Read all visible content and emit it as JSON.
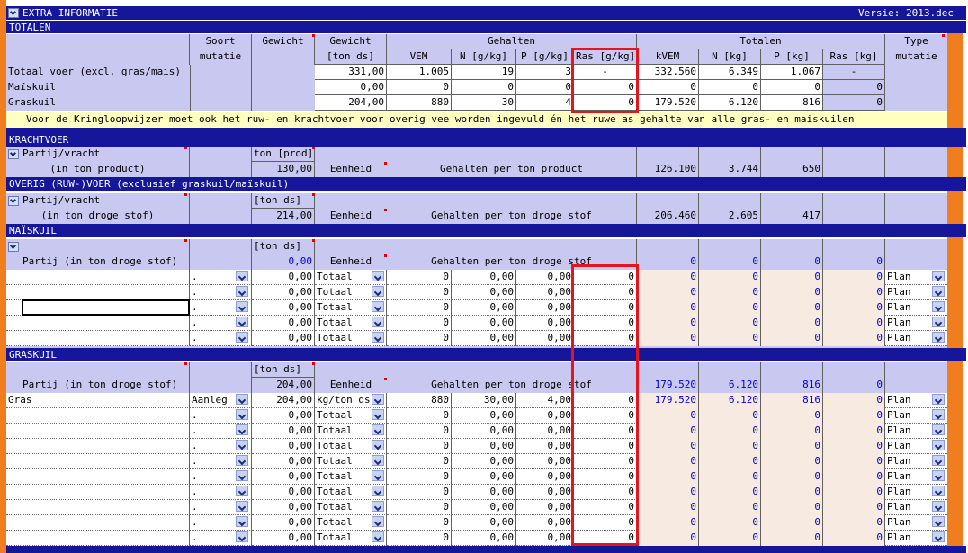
{
  "header": {
    "title": "EXTRA INFORMATIE",
    "version": "Versie: 2013.dec"
  },
  "totalen": {
    "section": "TOTALEN",
    "cols": {
      "soort": "Soort",
      "mutatie": "mutatie",
      "gewicht1": "Gewicht",
      "gewicht2": "Gewicht",
      "tonds": "[ton ds]",
      "gehalten": "Gehalten",
      "vem": "VEM",
      "n": "N [g/kg]",
      "p": "P [g/kg]",
      "ras": "Ras [g/kg]",
      "totalen": "Totalen",
      "kvem": "kVEM",
      "nkg": "N [kg]",
      "pkg": "P [kg]",
      "raskg": "Ras [kg]",
      "type": "Type",
      "typemut": "mutatie"
    },
    "rows": [
      {
        "label": "Totaal voer (excl. gras/mais)",
        "w": "331,00",
        "vem": "1.005",
        "n": "19",
        "p": "3",
        "ras": "-",
        "kvem": "332.560",
        "nkg": "6.349",
        "pkg": "1.067",
        "raskg": "-"
      },
      {
        "label": "Maïskuil",
        "w": "0,00",
        "vem": "0",
        "n": "0",
        "p": "0",
        "ras": "0",
        "kvem": "0",
        "nkg": "0",
        "pkg": "0",
        "raskg": "0"
      },
      {
        "label": "Graskuil",
        "w": "204,00",
        "vem": "880",
        "n": "30",
        "p": "4",
        "ras": "0",
        "kvem": "179.520",
        "nkg": "6.120",
        "pkg": "816",
        "raskg": "0"
      }
    ],
    "note": "Voor de Kringloopwijzer moet ook het ruw- en krachtvoer voor overig vee worden ingevuld én het ruwe as gehalte van alle gras- en maiskuilen"
  },
  "kracht": {
    "section": "KRACHTVOER",
    "partij": "Partij/vracht",
    "unit": "ton [prod]",
    "sub": "(in ton product)",
    "w": "130,00",
    "eenheid": "Eenheid",
    "gehalten": "Gehalten per ton product",
    "kvem": "126.100",
    "nkg": "3.744",
    "pkg": "650"
  },
  "overig": {
    "section": "OVERIG (RUW-)VOER (exclusief graskuil/maïskuil)",
    "partij": "Partij/vracht",
    "unit": "[ton ds]",
    "sub": "(in ton droge stof)",
    "w": "214,00",
    "eenheid": "Eenheid",
    "gehalten": "Gehalten per ton droge stof",
    "kvem": "206.460",
    "nkg": "2.605",
    "pkg": "417"
  },
  "mais": {
    "section": "MAÏSKUIL",
    "unit": "[ton ds]",
    "partij": "Partij (in ton droge stof)",
    "w": "0,00",
    "eenheid": "Eenheid",
    "gehalten": "Gehalten per ton droge stof",
    "kvem": "0",
    "nkg": "0",
    "pkg": "0",
    "raskg": "0",
    "rows": [
      {
        "name": "",
        "soort": ".",
        "w": "0,00",
        "eenheid": "Totaal",
        "vem": "0",
        "n": "0,00",
        "p": "0,00",
        "ras": "0",
        "kvem": "0",
        "nkg": "0",
        "pkg": "0",
        "raskg": "0",
        "type": "Plan"
      },
      {
        "name": "",
        "soort": ".",
        "w": "0,00",
        "eenheid": "Totaal",
        "vem": "0",
        "n": "0,00",
        "p": "0,00",
        "ras": "0",
        "kvem": "0",
        "nkg": "0",
        "pkg": "0",
        "raskg": "0",
        "type": "Plan"
      },
      {
        "name": "",
        "soort": ".",
        "w": "0,00",
        "eenheid": "Totaal",
        "vem": "0",
        "n": "0,00",
        "p": "0,00",
        "ras": "0",
        "kvem": "0",
        "nkg": "0",
        "pkg": "0",
        "raskg": "0",
        "type": "Plan"
      },
      {
        "name": "",
        "soort": ".",
        "w": "0,00",
        "eenheid": "Totaal",
        "vem": "0",
        "n": "0,00",
        "p": "0,00",
        "ras": "0",
        "kvem": "0",
        "nkg": "0",
        "pkg": "0",
        "raskg": "0",
        "type": "Plan"
      },
      {
        "name": "",
        "soort": ".",
        "w": "0,00",
        "eenheid": "Totaal",
        "vem": "0",
        "n": "0,00",
        "p": "0,00",
        "ras": "0",
        "kvem": "0",
        "nkg": "0",
        "pkg": "0",
        "raskg": "0",
        "type": "Plan"
      }
    ]
  },
  "gras": {
    "section": "GRASKUIL",
    "unit": "[ton ds]",
    "partij": "Partij (in ton droge stof)",
    "w": "204,00",
    "eenheid": "Eenheid",
    "gehalten": "Gehalten per ton droge stof",
    "kvem": "179.520",
    "nkg": "6.120",
    "pkg": "816",
    "raskg": "0",
    "rows": [
      {
        "name": "Gras",
        "soort": "Aanleg",
        "w": "204,00",
        "eenheid": "kg/ton ds",
        "vem": "880",
        "n": "30,00",
        "p": "4,00",
        "ras": "0",
        "kvem": "179.520",
        "nkg": "6.120",
        "pkg": "816",
        "raskg": "0",
        "type": "Plan"
      },
      {
        "name": "",
        "soort": ".",
        "w": "0,00",
        "eenheid": "Totaal",
        "vem": "0",
        "n": "0,00",
        "p": "0,00",
        "ras": "0",
        "kvem": "0",
        "nkg": "0",
        "pkg": "0",
        "raskg": "0",
        "type": "Plan"
      },
      {
        "name": "",
        "soort": ".",
        "w": "0,00",
        "eenheid": "Totaal",
        "vem": "0",
        "n": "0,00",
        "p": "0,00",
        "ras": "0",
        "kvem": "0",
        "nkg": "0",
        "pkg": "0",
        "raskg": "0",
        "type": "Plan"
      },
      {
        "name": "",
        "soort": ".",
        "w": "0,00",
        "eenheid": "Totaal",
        "vem": "0",
        "n": "0,00",
        "p": "0,00",
        "ras": "0",
        "kvem": "0",
        "nkg": "0",
        "pkg": "0",
        "raskg": "0",
        "type": "Plan"
      },
      {
        "name": "",
        "soort": ".",
        "w": "0,00",
        "eenheid": "Totaal",
        "vem": "0",
        "n": "0,00",
        "p": "0,00",
        "ras": "0",
        "kvem": "0",
        "nkg": "0",
        "pkg": "0",
        "raskg": "0",
        "type": "Plan"
      },
      {
        "name": "",
        "soort": ".",
        "w": "0,00",
        "eenheid": "Totaal",
        "vem": "0",
        "n": "0,00",
        "p": "0,00",
        "ras": "0",
        "kvem": "0",
        "nkg": "0",
        "pkg": "0",
        "raskg": "0",
        "type": "Plan"
      },
      {
        "name": "",
        "soort": ".",
        "w": "0,00",
        "eenheid": "Totaal",
        "vem": "0",
        "n": "0,00",
        "p": "0,00",
        "ras": "0",
        "kvem": "0",
        "nkg": "0",
        "pkg": "0",
        "raskg": "0",
        "type": "Plan"
      },
      {
        "name": "",
        "soort": ".",
        "w": "0,00",
        "eenheid": "Totaal",
        "vem": "0",
        "n": "0,00",
        "p": "0,00",
        "ras": "0",
        "kvem": "0",
        "nkg": "0",
        "pkg": "0",
        "raskg": "0",
        "type": "Plan"
      },
      {
        "name": "",
        "soort": ".",
        "w": "0,00",
        "eenheid": "Totaal",
        "vem": "0",
        "n": "0,00",
        "p": "0,00",
        "ras": "0",
        "kvem": "0",
        "nkg": "0",
        "pkg": "0",
        "raskg": "0",
        "type": "Plan"
      },
      {
        "name": "",
        "soort": ".",
        "w": "0,00",
        "eenheid": "Totaal",
        "vem": "0",
        "n": "0,00",
        "p": "0,00",
        "ras": "0",
        "kvem": "0",
        "nkg": "0",
        "pkg": "0",
        "raskg": "0",
        "type": "Plan"
      }
    ]
  },
  "colors": {
    "section": "#16169a",
    "grid": "#c8c8f0",
    "orange": "#f07d1e",
    "highlight": "#e4151c",
    "note": "#ffffc0"
  }
}
